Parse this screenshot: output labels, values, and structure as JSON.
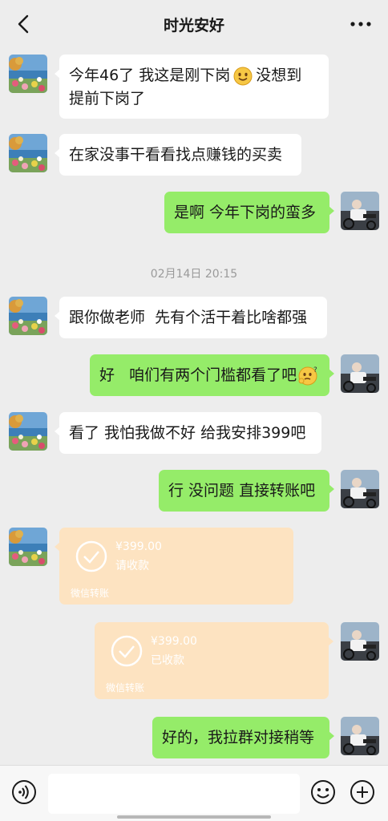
{
  "header": {
    "title": "时光安好"
  },
  "messages": {
    "m1": {
      "line1": "今年46了 我这是刚下岗",
      "line1b": "没想到",
      "line2": "提前下岗了"
    },
    "m2": "在家没事干看看找点赚钱的买卖",
    "m3": "是啊 今年下岗的蛮多",
    "timestamp": "02月14日 20:15",
    "m4": "跟你做老师  先有个活干着比啥都强",
    "m5": "好   咱们有两个门槛都看了吧",
    "m6": "看了 我怕我做不好 给我安排399吧",
    "m7": "行 没问题 直接转账吧",
    "transfer1": {
      "amount": "¥399.00",
      "status": "请收款",
      "brand": "微信转账"
    },
    "transfer2": {
      "amount": "¥399.00",
      "status": "已收款",
      "brand": "微信转账"
    },
    "m8": "好的，我拉群对接稍等"
  },
  "icons": {
    "back": "chevron-left-icon",
    "more": "more-dots-icon",
    "smile_emoji": "smile-emoji-icon",
    "think_emoji": "thinking-emoji-icon",
    "voice": "voice-icon",
    "emoji_button": "emoji-icon",
    "plus": "plus-icon"
  },
  "colors": {
    "incoming": "#ffffff",
    "outgoing": "#95ec69",
    "transfer": "#fde3c1",
    "background": "#ededed"
  }
}
